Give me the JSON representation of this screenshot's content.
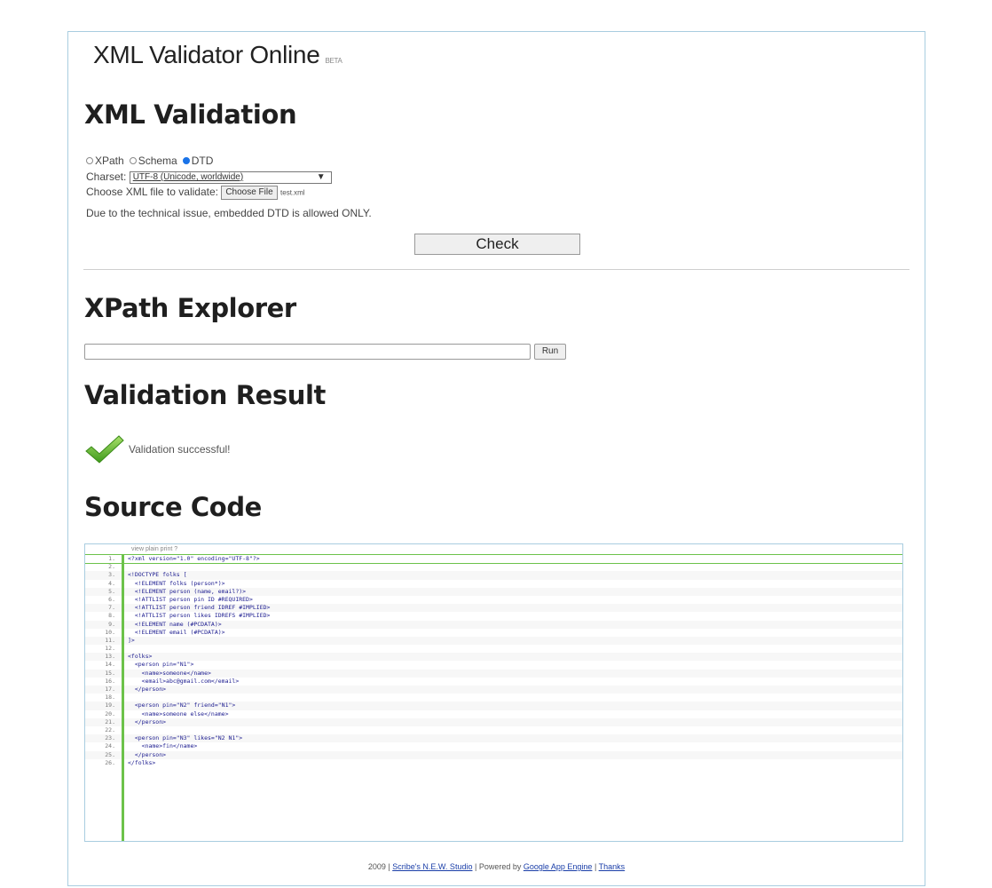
{
  "site": {
    "title": "XML Validator Online",
    "beta": "BETA"
  },
  "validation": {
    "heading": "XML Validation",
    "modes": [
      {
        "label": "XPath",
        "selected": false
      },
      {
        "label": "Schema",
        "selected": false
      },
      {
        "label": "DTD",
        "selected": true
      }
    ],
    "charset_label": "Charset:",
    "charset_value": "UTF-8 (Unicode, worldwide)",
    "file_label": "Choose XML file to validate:",
    "file_button": "Choose File",
    "file_name": "test.xml",
    "notice": "Due to the technical issue, embedded DTD is allowed ONLY.",
    "check_button": "Check"
  },
  "xpath": {
    "heading": "XPath Explorer",
    "input_value": "",
    "run_button": "Run"
  },
  "result": {
    "heading": "Validation Result",
    "message": "Validation successful!"
  },
  "source": {
    "heading": "Source Code",
    "toolbar": "view plain  print  ?",
    "lines": [
      "<?xml version=\"1.0\" encoding=\"UTF-8\"?>",
      "",
      "<!DOCTYPE folks [",
      "  <!ELEMENT folks (person*)>",
      "  <!ELEMENT person (name, email?)>",
      "  <!ATTLIST person pin ID #REQUIRED>",
      "  <!ATTLIST person friend IDREF #IMPLIED>",
      "  <!ATTLIST person likes IDREFS #IMPLIED>",
      "  <!ELEMENT name (#PCDATA)>",
      "  <!ELEMENT email (#PCDATA)>",
      "]>",
      "",
      "<folks>",
      "  <person pin=\"N1\">",
      "    <name>someone</name>",
      "    <email>abc@gmail.com</email>",
      "  </person>",
      "",
      "  <person pin=\"N2\" friend=\"N1\">",
      "    <name>someone else</name>",
      "  </person>",
      "",
      "  <person pin=\"N3\" likes=\"N2 N1\">",
      "    <name>fin</name>",
      "  </person>",
      "</folks>"
    ]
  },
  "footer": {
    "year": "2009 |",
    "studio_link": "Scribe's N.E.W. Studio",
    "powered": "| Powered by",
    "engine_link": "Google App Engine",
    "sep": "|",
    "thanks_link": "Thanks"
  }
}
